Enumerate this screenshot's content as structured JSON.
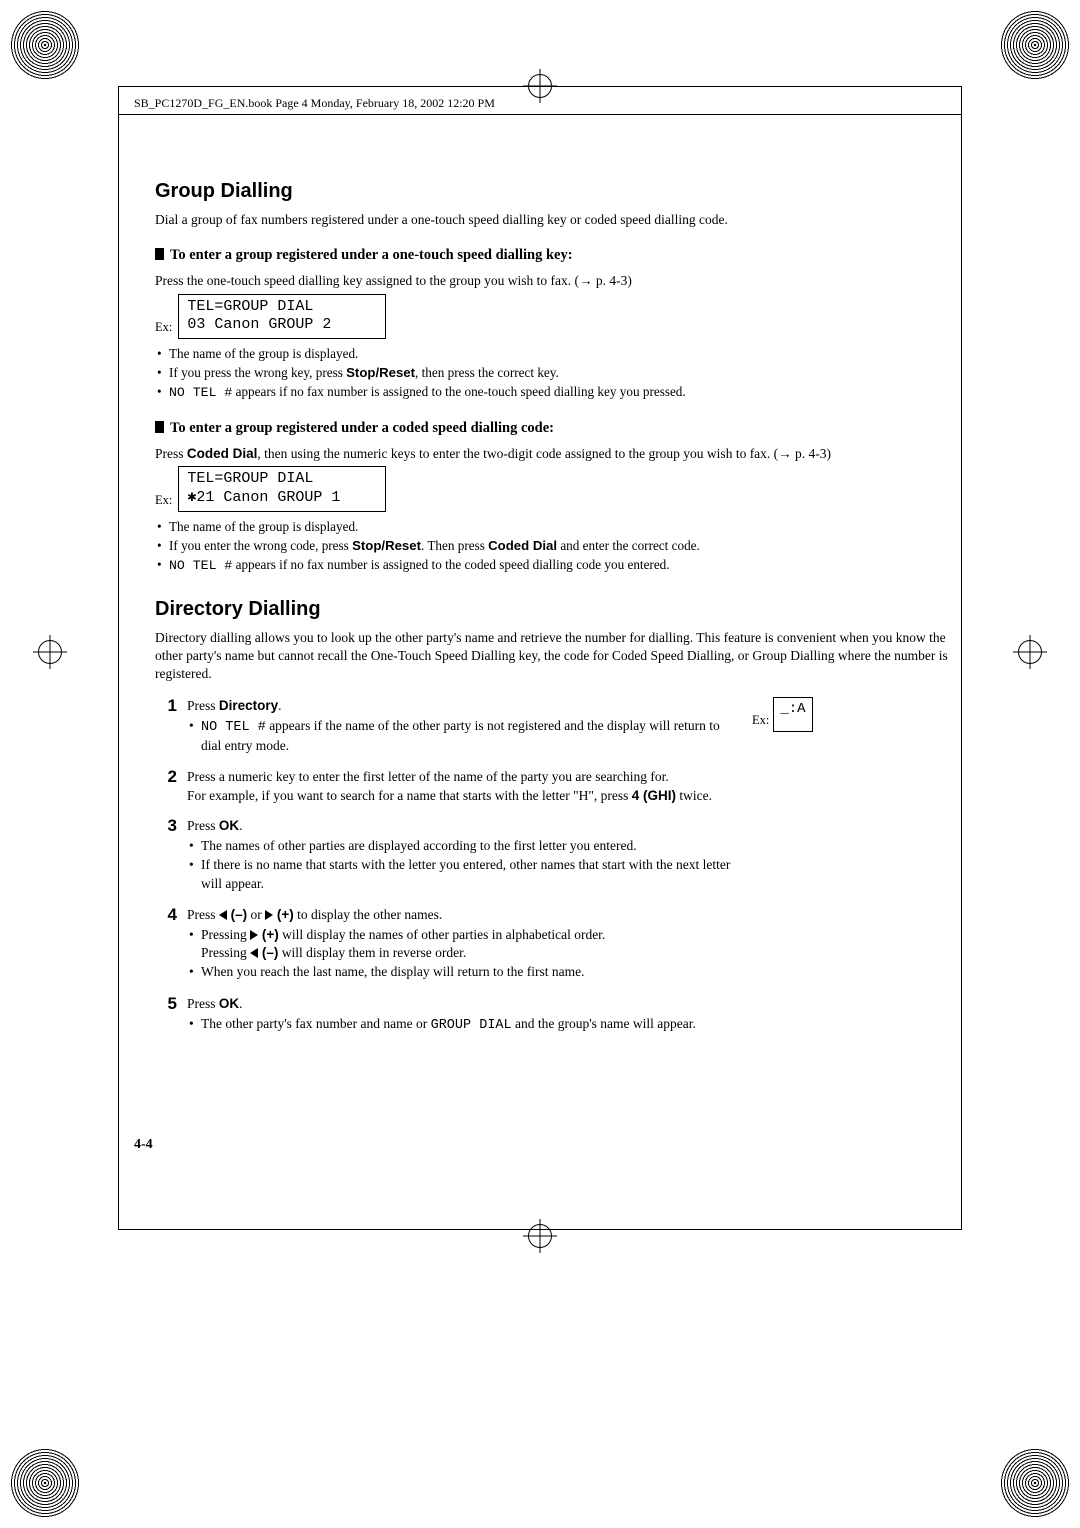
{
  "header": {
    "runner": "SB_PC1270D_FG_EN.book  Page 4  Monday, February 18, 2002  12:20 PM"
  },
  "section1": {
    "title": "Group Dialling",
    "intro": "Dial a group of fax numbers registered under a one-touch speed dialling key or coded speed dialling code.",
    "sub1_title": "To enter a group registered under a one-touch speed dialling key:",
    "sub1_instr_pre": "Press the one-touch speed dialling key assigned to the group you wish to fax. (",
    "sub1_instr_arrow": "→",
    "sub1_instr_post": " p. 4-3)",
    "ex_label": "Ex:",
    "lcd1": "TEL=GROUP DIAL\n03 Canon GROUP 2",
    "bullets1": [
      {
        "text": "The name of the group is displayed."
      },
      {
        "pre": "If you press the wrong key, press ",
        "bold1": "Stop/Reset",
        "post": ", then press the correct key."
      },
      {
        "mono": "NO TEL #",
        "post": " appears if no fax number is assigned to the one-touch speed dialling key you pressed."
      }
    ],
    "sub2_title": "To enter a group registered under a coded speed dialling code:",
    "sub2_instr_pre": "Press ",
    "sub2_instr_bold": "Coded Dial",
    "sub2_instr_mid": ", then using the numeric keys to enter the two-digit code assigned to the group you wish to fax. (",
    "sub2_instr_arrow": "→",
    "sub2_instr_post": " p. 4-3)",
    "lcd2_l1": "TEL=GROUP DIAL",
    "lcd2_star": "✱",
    "lcd2_l2_post": "21 Canon GROUP 1",
    "bullets2": [
      {
        "text": "The name of the group is displayed."
      },
      {
        "pre": "If you enter the wrong code, press ",
        "bold1": "Stop/Reset",
        "mid": ". Then press ",
        "bold2": "Coded Dial",
        "post": " and enter the correct code."
      },
      {
        "mono": "NO TEL #",
        "post": " appears if no fax number is assigned to the coded speed dialling code you entered."
      }
    ]
  },
  "section2": {
    "title": "Directory Dialling",
    "intro": "Directory dialling allows you to look up the other party's name and retrieve the number for dialling. This feature is convenient when you know the other party's name but cannot recall the One-Touch Speed Dialling key, the code for Coded Speed Dialling, or Group Dialling where the number is registered.",
    "right_box_right": ":A",
    "right_box_cursor": "_",
    "ex_label": "Ex:",
    "steps": [
      {
        "num": "1",
        "line_pre": "Press ",
        "line_bold": "Directory",
        "line_post": ".",
        "subs": [
          {
            "mono": "NO TEL #",
            "post": " appears if the name of the other party is not registered and the display will return to dial entry mode."
          }
        ]
      },
      {
        "num": "2",
        "line_text": "Press a numeric key to enter the first letter of the name of the party you are searching for.",
        "after_pre": "For example, if you want to search for a name that starts with the letter \"H\", press ",
        "after_bold": "4 (GHI)",
        "after_post": " twice."
      },
      {
        "num": "3",
        "line_pre": "Press ",
        "line_bold": "OK",
        "line_post": ".",
        "subs": [
          {
            "text": "The names of other parties are displayed according to the first letter you entered."
          },
          {
            "text": "If there is no name that starts with the letter you entered, other names that start with the next letter will appear."
          }
        ]
      },
      {
        "num": "4",
        "line_pre": "Press ",
        "line_mid1": " (–)",
        "line_or": " or ",
        "line_mid2": " (+)",
        "line_post": " to display the other names.",
        "subs": [
          {
            "pre": "Pressing ",
            "tri": "right",
            "mid": " (+)",
            "post": " will display the names of other parties in alphabetical order.",
            "line2_pre": "Pressing ",
            "line2_tri": "left",
            "line2_mid": " (–)",
            "line2_post": " will display them in reverse order."
          },
          {
            "text": "When you reach the last name, the display will return to the first name."
          }
        ]
      },
      {
        "num": "5",
        "line_pre": "Press ",
        "line_bold": "OK",
        "line_post": ".",
        "subs": [
          {
            "pre": "The other party's fax number and name or ",
            "mono": "GROUP DIAL",
            "post": " and the group's name will appear."
          }
        ]
      }
    ]
  },
  "pageNum": "4-4"
}
